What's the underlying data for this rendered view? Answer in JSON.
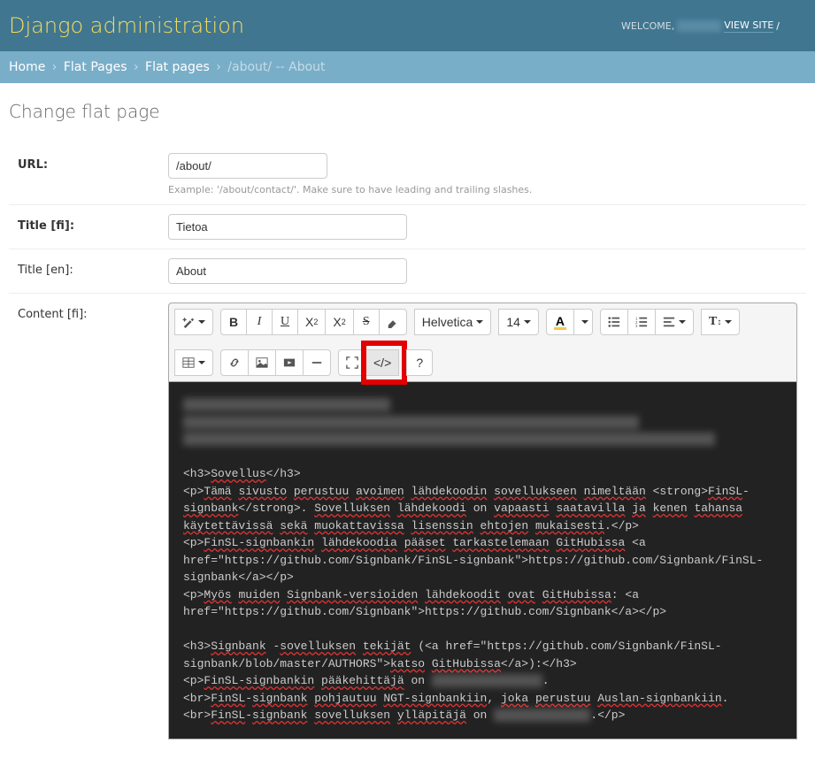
{
  "header": {
    "title": "Django administration",
    "welcome": "WELCOME,",
    "view_site": "VIEW SITE",
    "sep": "/"
  },
  "breadcrumbs": {
    "home": "Home",
    "app": "Flat Pages",
    "model": "Flat pages",
    "current": "/about/ -- About"
  },
  "page": {
    "heading": "Change flat page"
  },
  "form": {
    "url_label": "URL:",
    "url_value": "/about/",
    "url_help": "Example: '/about/contact/'. Make sure to have leading and trailing slashes.",
    "title_fi_label": "Title [fi]:",
    "title_fi_value": "Tietoa",
    "title_en_label": "Title [en]:",
    "title_en_value": "About",
    "content_fi_label": "Content [fi]:"
  },
  "toolbar": {
    "font_name": "Helvetica",
    "font_size": "14",
    "bold": "B",
    "italic": "I",
    "fontcolor": "A",
    "height": "T↕",
    "codeview": "</>",
    "help": "?"
  },
  "code": {
    "l1": "<h3>",
    "w_sovellus": "Sovellus",
    "l1b": "</h3>",
    "p1a": "<p>",
    "w_tama": "Tämä",
    "w_sivusto": "sivusto",
    "w_perustuu": "perustuu",
    "w_avoimen": "avoimen",
    "w_lahdekoodin": "lähdekoodin",
    "w_sovellukseen": "sovellukseen",
    "w_nimeltaan": "nimeltään",
    "tag_strong_o": " <strong>",
    "w_finsl": "FinSL",
    "dash": "-",
    "w_signbank": "signbank",
    "tag_strong_c": "</strong>. ",
    "w_sovelluksen_cap": "Sovelluksen",
    "w_lahdekoodi": "lähdekoodi",
    "w_on": "on",
    "w_vapaasti": "vapaasti",
    "w_saatavilla": "saatavilla",
    "w_ja": "ja",
    "w_kenen": "kenen",
    "w_tahansa": "tahansa",
    "w_kaytettavissa": "käytettävissä",
    "w_seka": "sekä",
    "w_muokattavissa": "muokattavissa",
    "w_lisenssin": "lisenssin",
    "w_ehtojen": "ehtojen",
    "w_mukaisesti": "mukaisesti",
    "p1_end": ".</p>",
    "p2a": "<p>",
    "w_finsl_signbankin": "FinSL-signbankin",
    "w_lahdekoodia": "lähdekoodia",
    "w_paaset": "pääset",
    "w_tarkastelemaan": "tarkastelemaan",
    "w_githubissa": "GitHubissa",
    "tag_a_o": " <a ",
    "href1": "href=\"https://github.com/Signbank/FinSL-signbank\">https://github.com/Signbank/FinSL-signbank</a></p>",
    "p3a": "<p>",
    "w_myos": "Myös",
    "w_muiden": "muiden",
    "w_signbank_versioiden": "Signbank-versioiden",
    "w_lahdekoodit": "lähdekoodit",
    "w_ovat": "ovat",
    "href2": ": <a href=\"https://github.com/Signbank\">https://github.com/Signbank</a></p>",
    "h3b_o": "<h3>",
    "w_signbank_cap": "Signbank",
    "w_sovelluksen": "sovelluksen",
    "w_tekijat": "tekijät",
    "paren": " (<a href=\"https://github.com/Signbank/FinSL-signbank/blob/master/AUTHORS\">",
    "w_katso": "katso",
    "w_githubissa2": "GitHubissa",
    "h3b_c": "</a>):</h3>",
    "p4a": "<p>",
    "w_paakehittaja": "pääkehittäjä",
    "dot": ".",
    "br": "<br>",
    "w_pohjautuu": "pohjautuu",
    "w_ngt": "NGT-signbankiin",
    "comma": ", ",
    "w_joka": "joka",
    "w_auslan": "Auslan-signbankiin",
    "w_yllapitaja": "ylläpitäjä",
    "p4_end": ".</p>"
  }
}
